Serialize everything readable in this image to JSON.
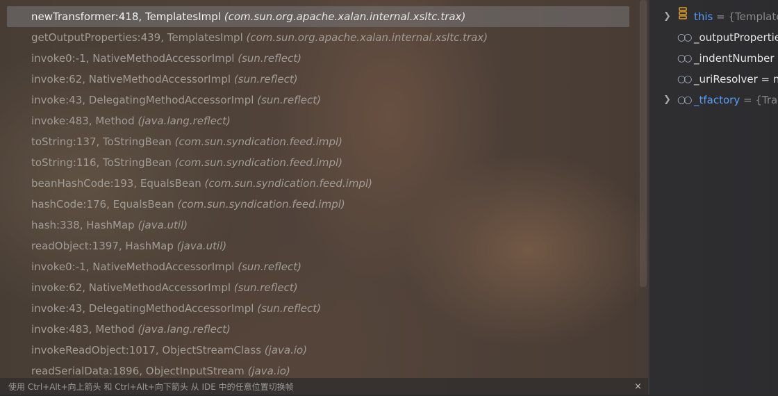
{
  "frames": [
    {
      "method": "newTransformer:418, TemplatesImpl",
      "pkg": "(com.sun.org.apache.xalan.internal.xsltc.trax)",
      "selected": true
    },
    {
      "method": "getOutputProperties:439, TemplatesImpl",
      "pkg": "(com.sun.org.apache.xalan.internal.xsltc.trax)"
    },
    {
      "method": "invoke0:-1, NativeMethodAccessorImpl",
      "pkg": "(sun.reflect)"
    },
    {
      "method": "invoke:62, NativeMethodAccessorImpl",
      "pkg": "(sun.reflect)"
    },
    {
      "method": "invoke:43, DelegatingMethodAccessorImpl",
      "pkg": "(sun.reflect)"
    },
    {
      "method": "invoke:483, Method",
      "pkg": "(java.lang.reflect)"
    },
    {
      "method": "toString:137, ToStringBean",
      "pkg": "(com.sun.syndication.feed.impl)"
    },
    {
      "method": "toString:116, ToStringBean",
      "pkg": "(com.sun.syndication.feed.impl)"
    },
    {
      "method": "beanHashCode:193, EqualsBean",
      "pkg": "(com.sun.syndication.feed.impl)"
    },
    {
      "method": "hashCode:176, EqualsBean",
      "pkg": "(com.sun.syndication.feed.impl)"
    },
    {
      "method": "hash:338, HashMap",
      "pkg": "(java.util)"
    },
    {
      "method": "readObject:1397, HashMap",
      "pkg": "(java.util)"
    },
    {
      "method": "invoke0:-1, NativeMethodAccessorImpl",
      "pkg": "(sun.reflect)"
    },
    {
      "method": "invoke:62, NativeMethodAccessorImpl",
      "pkg": "(sun.reflect)"
    },
    {
      "method": "invoke:43, DelegatingMethodAccessorImpl",
      "pkg": "(sun.reflect)"
    },
    {
      "method": "invoke:483, Method",
      "pkg": "(java.lang.reflect)"
    },
    {
      "method": "invokeReadObject:1017, ObjectStreamClass",
      "pkg": "(java.io)"
    },
    {
      "method": "readSerialData:1896, ObjectInputStream",
      "pkg": "(java.io)"
    }
  ],
  "variables": [
    {
      "name": "this",
      "value": " = {Template",
      "expandable": true,
      "icon": "object-stack-icon",
      "nameColor": "#589df6"
    },
    {
      "name": "_outputPropertie",
      "value": "",
      "expandable": false,
      "icon": "field-icon"
    },
    {
      "name": "_indentNumber",
      "value": " ",
      "expandable": false,
      "icon": "field-icon"
    },
    {
      "name": "_uriResolver",
      "value": " = nu",
      "expandable": false,
      "icon": "field-icon"
    },
    {
      "name": "_tfactory",
      "value": " = {Tran",
      "expandable": true,
      "icon": "field-icon",
      "nameColor": "#589df6"
    }
  ],
  "statusbar": {
    "hint": "使用 Ctrl+Alt+向上箭头 和 Ctrl+Alt+向下箭头 从 IDE 中的任意位置切换帧",
    "close": "×"
  },
  "colors": {
    "selected_row": "#787678",
    "link_blue": "#589df6",
    "frame_text": "#a29c95"
  }
}
